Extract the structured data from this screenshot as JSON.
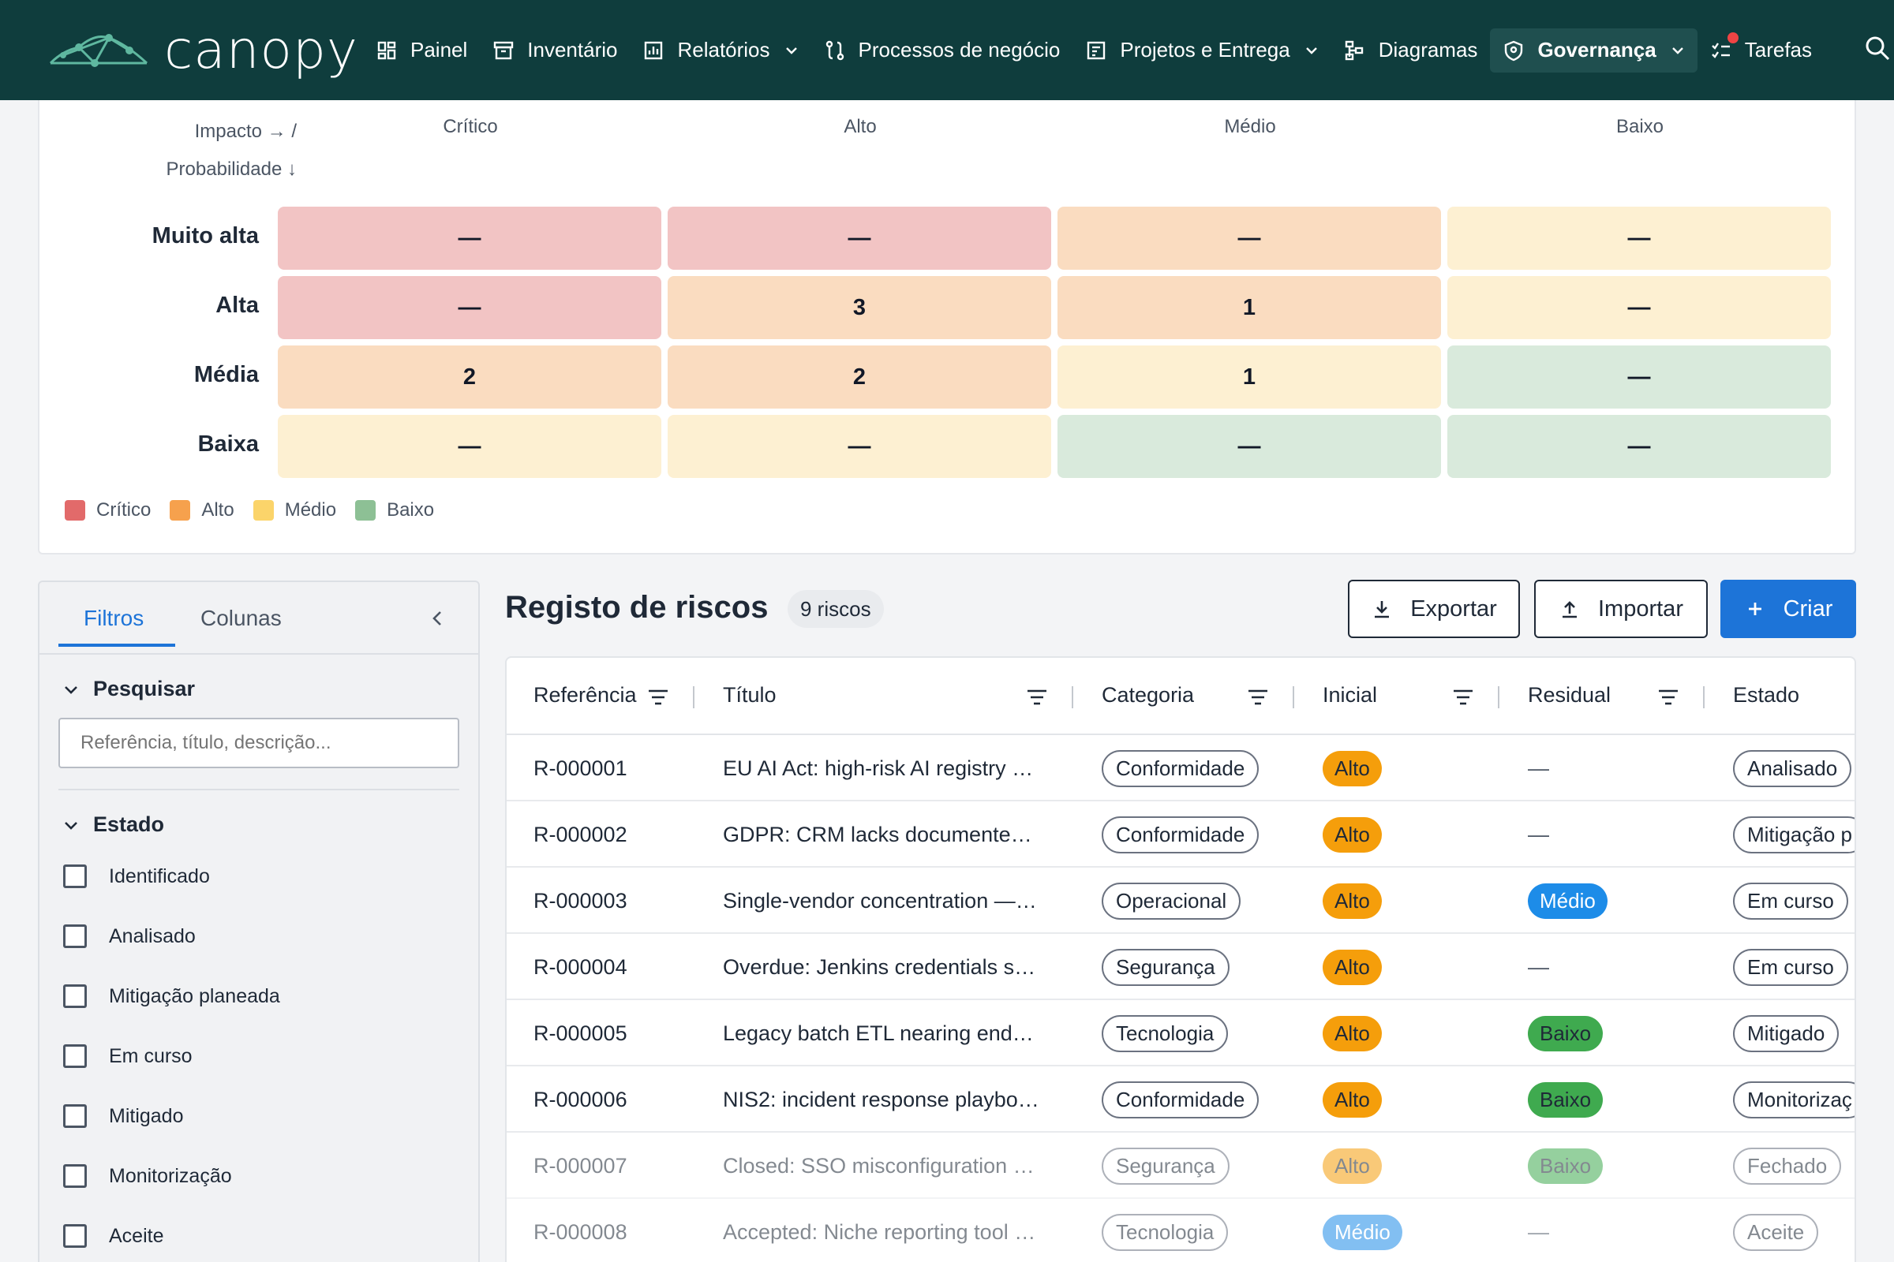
{
  "brand": {
    "name": "canopy"
  },
  "nav": {
    "items": [
      {
        "label": "Painel",
        "icon": "dashboard-icon"
      },
      {
        "label": "Inventário",
        "icon": "inventory-icon"
      },
      {
        "label": "Relatórios",
        "icon": "reports-icon"
      },
      {
        "label": "Processos de negócio",
        "icon": "process-icon"
      },
      {
        "label": "Projetos e Entrega",
        "icon": "projects-icon"
      },
      {
        "label": "Diagramas",
        "icon": "diagram-icon"
      },
      {
        "label": "Governança",
        "icon": "shield-icon"
      },
      {
        "label": "Tarefas",
        "icon": "tasks-icon"
      }
    ]
  },
  "heatmap": {
    "corner_line1": "Impacto → /",
    "corner_line2": "Probabilidade ↓",
    "columns": [
      "Crítico",
      "Alto",
      "Médio",
      "Baixo"
    ],
    "rows": [
      {
        "label": "Muito alta",
        "cells": [
          "—",
          "—",
          "—",
          "—"
        ]
      },
      {
        "label": "Alta",
        "cells": [
          "—",
          "3",
          "1",
          "—"
        ]
      },
      {
        "label": "Média",
        "cells": [
          "2",
          "2",
          "1",
          "—"
        ]
      },
      {
        "label": "Baixa",
        "cells": [
          "—",
          "—",
          "—",
          "—"
        ]
      }
    ],
    "legend": [
      {
        "label": "Crítico",
        "color": "#e26a6a"
      },
      {
        "label": "Alto",
        "color": "#f6a14d"
      },
      {
        "label": "Médio",
        "color": "#fbd46a"
      },
      {
        "label": "Baixo",
        "color": "#8dc095"
      }
    ]
  },
  "filters": {
    "tab_filters": "Filtros",
    "tab_columns": "Colunas",
    "collapse": "<",
    "search_section": "Pesquisar",
    "search_placeholder": "Referência, título, descrição...",
    "state_section": "Estado",
    "states": [
      "Identificado",
      "Analisado",
      "Mitigação planeada",
      "Em curso",
      "Mitigado",
      "Monitorização",
      "Aceite"
    ]
  },
  "register": {
    "title": "Registo de riscos",
    "count": "9 riscos",
    "export": "Exportar",
    "import": "Importar",
    "create": "Criar",
    "columns": [
      "Referência",
      "Título",
      "Categoria",
      "Inicial",
      "Residual",
      "Estado"
    ],
    "rows": [
      {
        "ref": "R-000001",
        "title": "EU AI Act: high-risk AI registry …",
        "category": "Conformidade",
        "initial": "Alto",
        "residual": "—",
        "state": "Analisado"
      },
      {
        "ref": "R-000002",
        "title": "GDPR: CRM lacks documente…",
        "category": "Conformidade",
        "initial": "Alto",
        "residual": "—",
        "state": "Mitigação p"
      },
      {
        "ref": "R-000003",
        "title": "Single-vendor concentration —…",
        "category": "Operacional",
        "initial": "Alto",
        "residual": "Médio",
        "state": "Em curso"
      },
      {
        "ref": "R-000004",
        "title": "Overdue: Jenkins credentials s…",
        "category": "Segurança",
        "initial": "Alto",
        "residual": "—",
        "state": "Em curso"
      },
      {
        "ref": "R-000005",
        "title": "Legacy batch ETL nearing end…",
        "category": "Tecnologia",
        "initial": "Alto",
        "residual": "Baixo",
        "state": "Mitigado"
      },
      {
        "ref": "R-000006",
        "title": "NIS2: incident response playbo…",
        "category": "Conformidade",
        "initial": "Alto",
        "residual": "Baixo",
        "state": "Monitorizaç"
      },
      {
        "ref": "R-000007",
        "title": "Closed: SSO misconfiguration …",
        "category": "Segurança",
        "initial": "Alto",
        "residual": "Baixo",
        "state": "Fechado"
      },
      {
        "ref": "R-000008",
        "title": "Accepted: Niche reporting tool …",
        "category": "Tecnologia",
        "initial": "Médio",
        "residual": "—",
        "state": "Aceite"
      }
    ]
  }
}
